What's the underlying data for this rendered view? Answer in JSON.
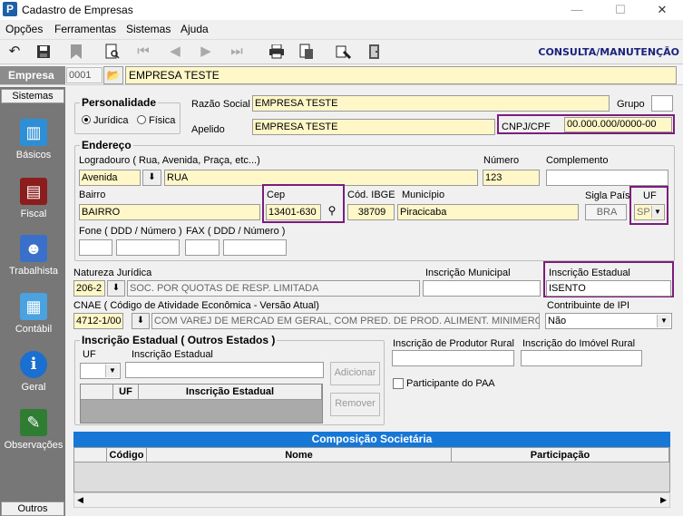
{
  "window": {
    "icon_letter": "P",
    "title": "Cadastro de Empresas",
    "minimize": "—",
    "maximize": "☐",
    "close": "✕"
  },
  "menu": [
    "Opções",
    "Ferramentas",
    "Sistemas",
    "Ajuda"
  ],
  "toolbar": {
    "mode": "CONSULTA/MANUTENÇÃO"
  },
  "empresa": {
    "label": "Empresa",
    "code": "0001",
    "name": "EMPRESA TESTE"
  },
  "sidebar": {
    "header": "Sistemas",
    "footer": "Outros",
    "items": [
      {
        "label": "Básicos",
        "icon": "books-icon"
      },
      {
        "label": "Fiscal",
        "icon": "receipt-icon"
      },
      {
        "label": "Trabalhista",
        "icon": "worker-icon"
      },
      {
        "label": "Contábil",
        "icon": "calculator-icon"
      },
      {
        "label": "Geral",
        "icon": "info-icon"
      },
      {
        "label": "Observações",
        "icon": "pen-icon"
      }
    ]
  },
  "personalidade": {
    "title": "Personalidade",
    "option_juridica": "Jurídica",
    "option_fisica": "Física",
    "selected": "Jurídica"
  },
  "razao_social": {
    "label": "Razão Social",
    "value": "EMPRESA TESTE"
  },
  "grupo": {
    "label": "Grupo",
    "value": ""
  },
  "apelido": {
    "label": "Apelido",
    "value": "EMPRESA TESTE"
  },
  "cnpj": {
    "label": "CNPJ/CPF",
    "value": "00.000.000/0000-00"
  },
  "endereco": {
    "title": "Endereço",
    "logradouro_label": "Logradouro ( Rua, Avenida, Praça, etc...)",
    "tipo": "Avenida",
    "logradouro": "RUA",
    "numero_label": "Número",
    "numero": "123",
    "complemento_label": "Complemento",
    "complemento": "",
    "bairro_label": "Bairro",
    "bairro": "BAIRRO",
    "cep_label": "Cep",
    "cep": "13401-630",
    "ibge_label": "Cód. IBGE",
    "ibge": "38709",
    "municipio_label": "Município",
    "municipio": "Piracicaba",
    "sigla_pais_label": "Sigla País",
    "sigla_pais": "BRA",
    "uf_label": "UF",
    "uf": "SP",
    "fone_label": "Fone ( DDD / Número )",
    "fax_label": "FAX ( DDD / Número )"
  },
  "natureza": {
    "label": "Natureza Jurídica",
    "code": "206-2",
    "desc": "SOC. POR QUOTAS DE RESP. LIMITADA"
  },
  "insc_municipal": {
    "label": "Inscrição Municipal",
    "value": ""
  },
  "insc_estadual": {
    "label": "Inscrição Estadual",
    "value": "ISENTO"
  },
  "cnae": {
    "label": "CNAE ( Código de Atividade Econômica - Versão Atual)",
    "code": "4712-1/00",
    "desc": "COM VAREJ DE MERCAD EM GERAL, COM PRED. DE PROD. ALIMENT. MINIMERCADOS, ..."
  },
  "contrib_ipi": {
    "label": "Contribuinte de IPI",
    "value": "Não"
  },
  "ie_outros": {
    "title": "Inscrição Estadual ( Outros Estados )",
    "uf_label": "UF",
    "ie_label": "Inscrição Estadual",
    "add_button": "Adicionar",
    "remove_button": "Remover",
    "col_uf": "UF",
    "col_ie": "Inscrição Estadual"
  },
  "produtor_rural": {
    "label": "Inscrição de Produtor Rural",
    "value": ""
  },
  "imovel_rural": {
    "label": "Inscrição do Imóvel Rural",
    "value": ""
  },
  "paa": {
    "label": "Participante do PAA",
    "checked": false
  },
  "composicao": {
    "title": "Composição Societária",
    "col_codigo": "Código",
    "col_nome": "Nome",
    "col_participacao": "Participação"
  }
}
